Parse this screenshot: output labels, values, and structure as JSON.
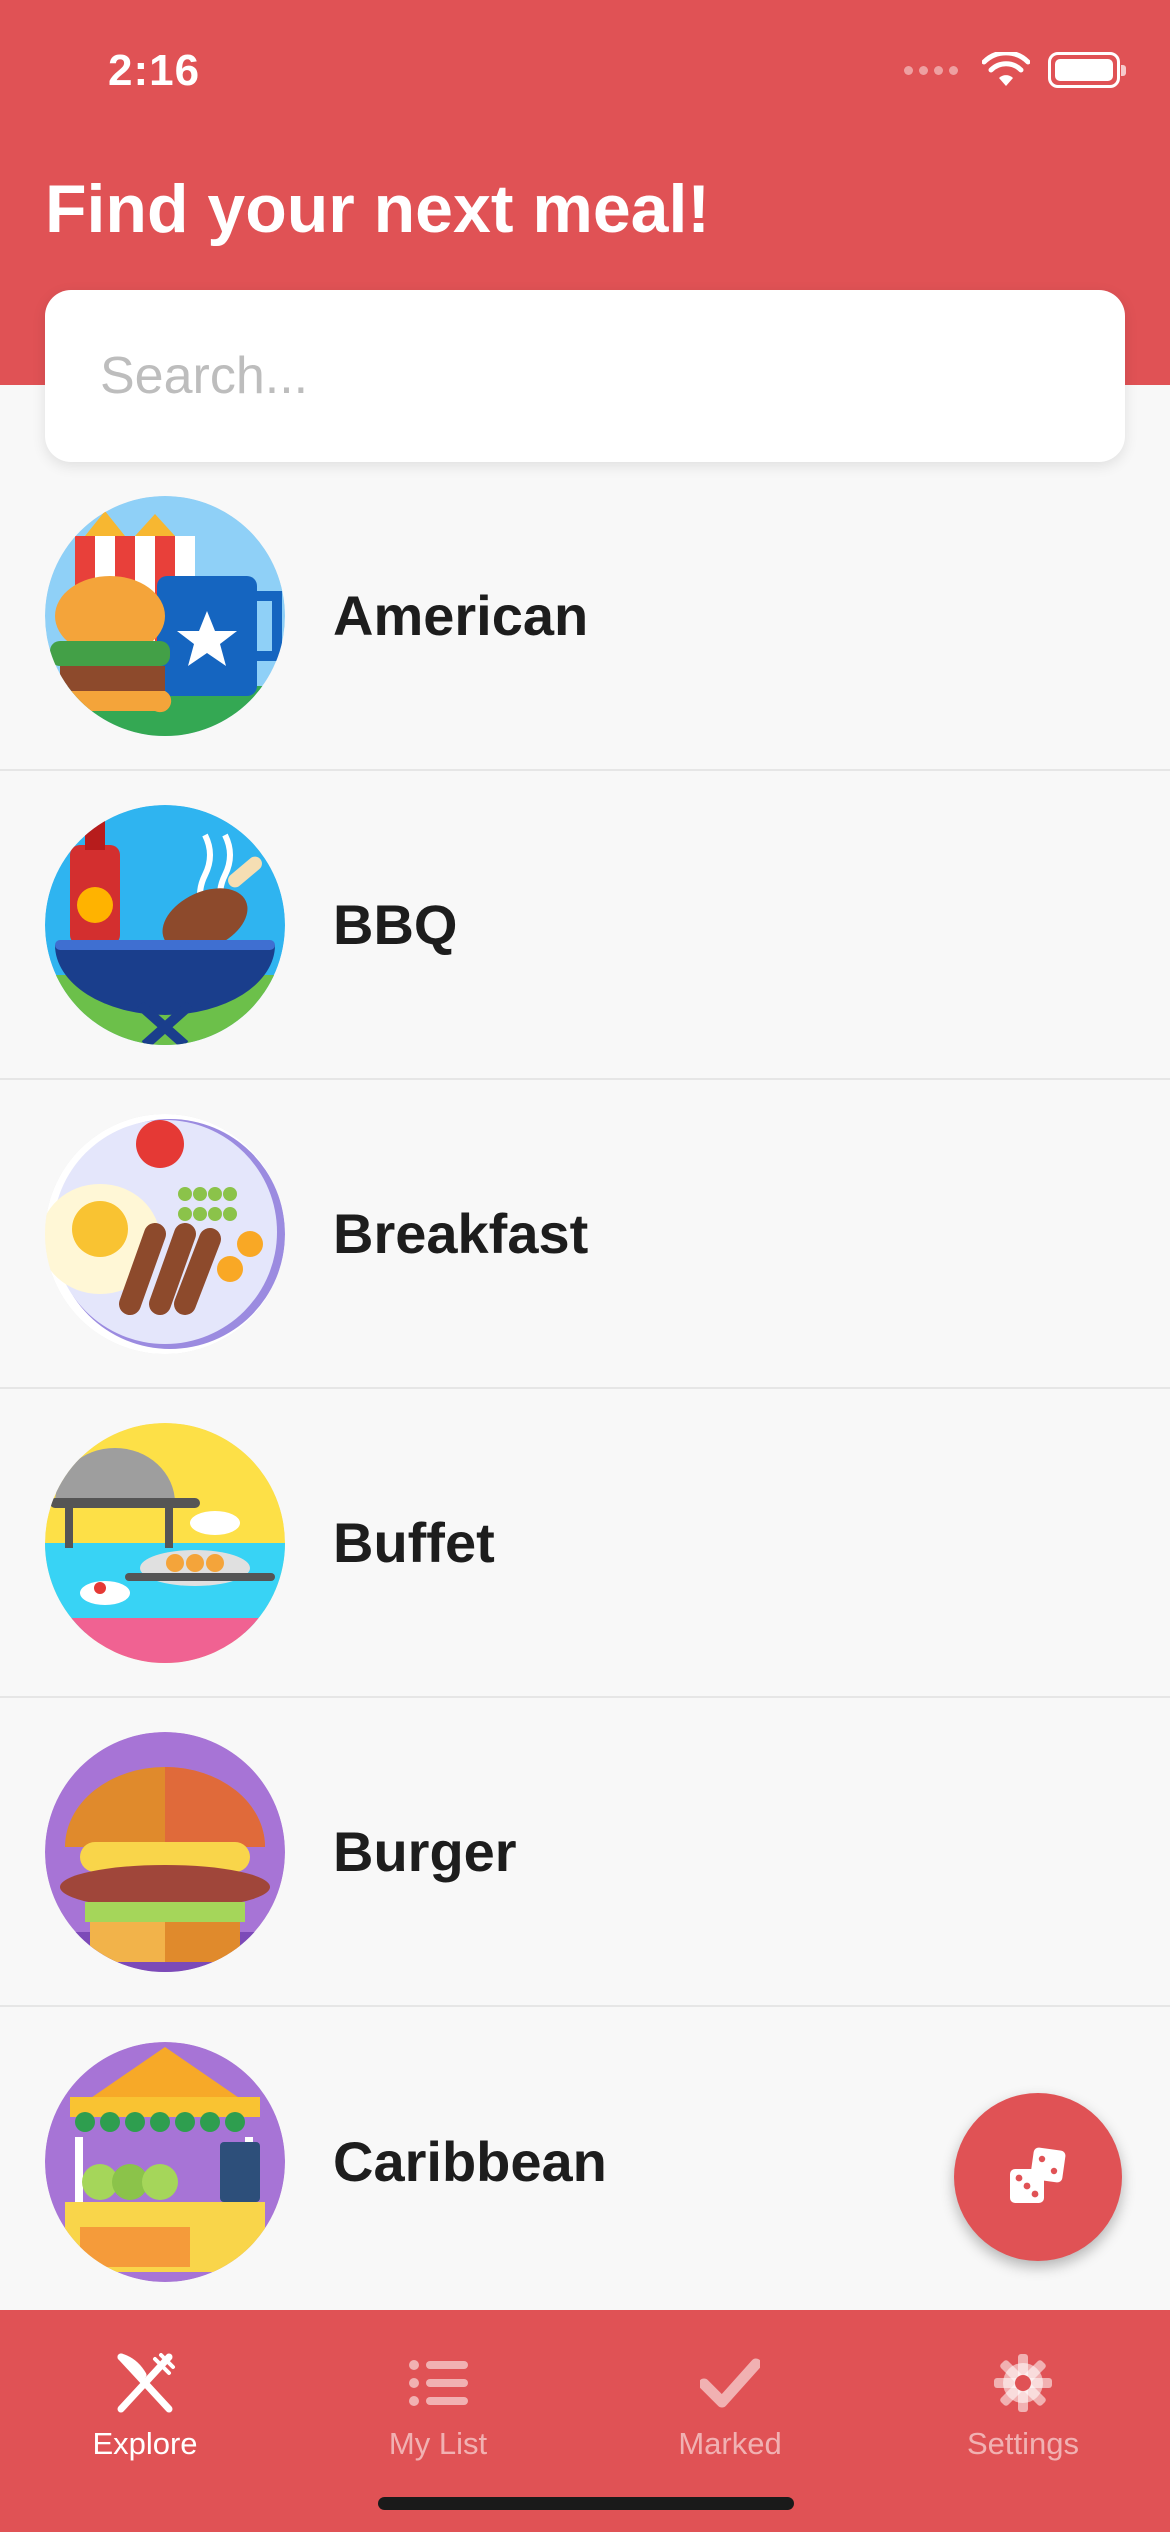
{
  "status_bar": {
    "time": "2:16"
  },
  "header": {
    "title": "Find your next meal!"
  },
  "search": {
    "placeholder": "Search...",
    "value": ""
  },
  "cuisines": [
    {
      "label": "American",
      "icon": "american-food-icon"
    },
    {
      "label": "BBQ",
      "icon": "bbq-grill-icon"
    },
    {
      "label": "Breakfast",
      "icon": "breakfast-plate-icon"
    },
    {
      "label": "Buffet",
      "icon": "buffet-icon"
    },
    {
      "label": "Burger",
      "icon": "burger-icon"
    },
    {
      "label": "Caribbean",
      "icon": "caribbean-stall-icon"
    }
  ],
  "fab": {
    "icon": "dice-icon"
  },
  "tabs": [
    {
      "label": "Explore",
      "icon": "fork-knife-icon",
      "active": true
    },
    {
      "label": "My List",
      "icon": "list-icon",
      "active": false
    },
    {
      "label": "Marked",
      "icon": "checkmark-icon",
      "active": false
    },
    {
      "label": "Settings",
      "icon": "gear-icon",
      "active": false
    }
  ],
  "colors": {
    "primary": "#e05255",
    "background": "#f8f8f8",
    "text": "#1d1d1d"
  }
}
